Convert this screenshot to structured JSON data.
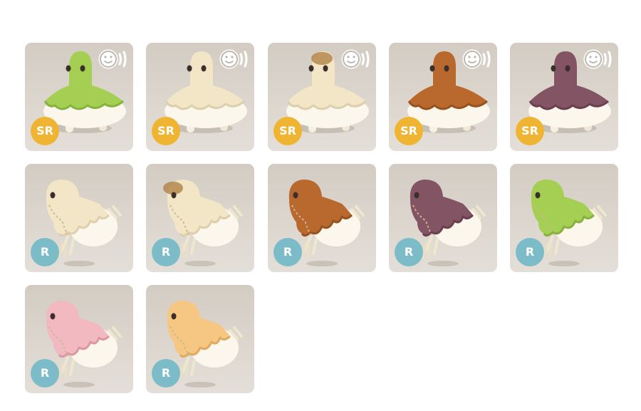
{
  "rarity_colors": {
    "SR": "#efb432",
    "R": "#7cbcc8"
  },
  "voice_icon": "speaking-face-icon",
  "cards": [
    {
      "pose": "standing",
      "rarity": "SR",
      "hood": "#a4cf52",
      "hood_edge": "#86b23f",
      "tip": null,
      "voice": true
    },
    {
      "pose": "standing",
      "rarity": "SR",
      "hood": "#f2e6c6",
      "hood_edge": "#ddceac",
      "tip": null,
      "voice": true
    },
    {
      "pose": "standing",
      "rarity": "SR",
      "hood": "#f2e6c6",
      "hood_edge": "#ddceac",
      "tip": "#b5874e",
      "voice": true
    },
    {
      "pose": "standing",
      "rarity": "SR",
      "hood": "#b9692d",
      "hood_edge": "#96521f",
      "tip": null,
      "voice": true
    },
    {
      "pose": "standing",
      "rarity": "SR",
      "hood": "#835463",
      "hood_edge": "#6a404e",
      "tip": null,
      "voice": true
    },
    {
      "pose": "floating",
      "rarity": "R",
      "hood": "#f2e6c6",
      "hood_edge": "#ddceac",
      "tip": null,
      "voice": false
    },
    {
      "pose": "floating",
      "rarity": "R",
      "hood": "#f2e6c6",
      "hood_edge": "#ddceac",
      "tip": "#b5874e",
      "voice": false
    },
    {
      "pose": "floating",
      "rarity": "R",
      "hood": "#b9692d",
      "hood_edge": "#96521f",
      "tip": null,
      "voice": false
    },
    {
      "pose": "floating",
      "rarity": "R",
      "hood": "#835463",
      "hood_edge": "#6a404e",
      "tip": null,
      "voice": false
    },
    {
      "pose": "floating",
      "rarity": "R",
      "hood": "#a4cf52",
      "hood_edge": "#86b23f",
      "tip": null,
      "voice": false
    },
    {
      "pose": "floating",
      "rarity": "R",
      "hood": "#f3b9c0",
      "hood_edge": "#dc98a2",
      "tip": null,
      "voice": false
    },
    {
      "pose": "floating",
      "rarity": "R",
      "hood": "#f5c783",
      "hood_edge": "#deaa62",
      "tip": null,
      "voice": false
    }
  ]
}
